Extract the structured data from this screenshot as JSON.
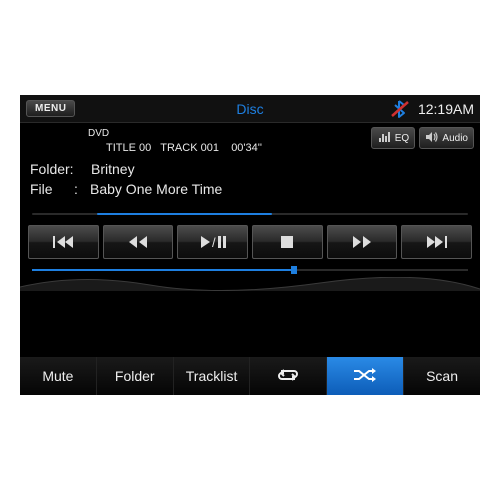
{
  "header": {
    "menu_label": "MENU",
    "source_label": "Disc",
    "clock": "12:19AM"
  },
  "disc": {
    "media_type": "DVD",
    "title_label": "TITLE",
    "title_num": "00",
    "track_label": "TRACK",
    "track_num": "001",
    "elapsed": "00'34''"
  },
  "side": {
    "eq_label": "EQ",
    "audio_label": "Audio"
  },
  "meta": {
    "folder_label": "Folder:",
    "folder_value": "Britney",
    "file_label": "File",
    "file_colon": ":",
    "file_value": "Baby One More Time"
  },
  "bottom": {
    "mute": "Mute",
    "folder": "Folder",
    "tracklist": "Tracklist",
    "scan": "Scan"
  }
}
